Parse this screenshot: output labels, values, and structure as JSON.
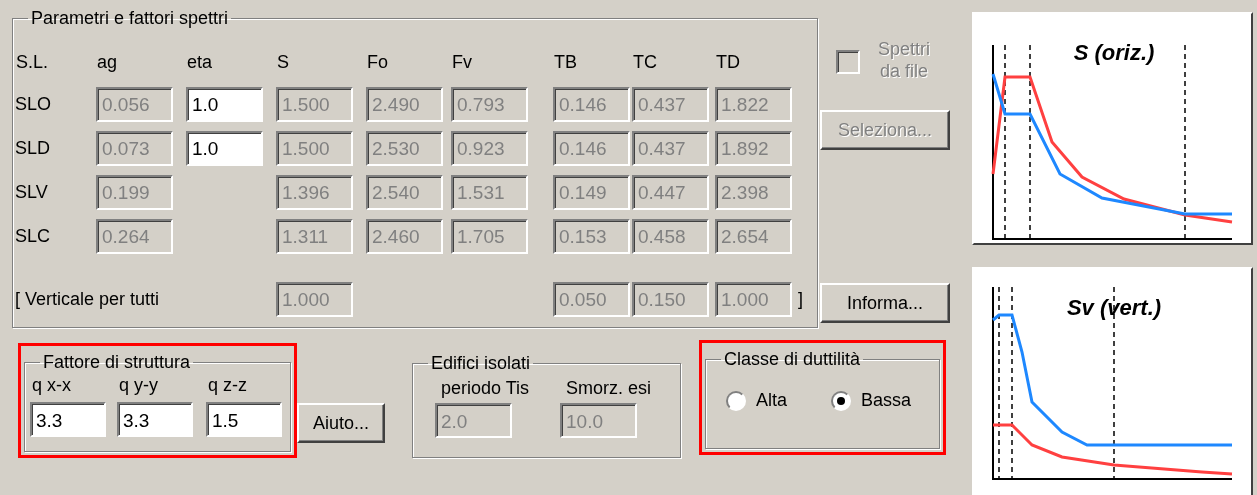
{
  "spectra": {
    "title": "Parametri e fattori spettri",
    "label_column": "S.L.",
    "columns": [
      "ag",
      "eta",
      "S",
      "Fo",
      "Fv",
      "TB",
      "TC",
      "TD"
    ],
    "rows": [
      {
        "kind": "state",
        "label": "SLO",
        "cells": [
          {
            "value": "0.056",
            "disabled": true
          },
          {
            "value": "1.0",
            "disabled": false
          },
          {
            "value": "1.500",
            "disabled": true
          },
          {
            "value": "2.490",
            "disabled": true
          },
          {
            "value": "0.793",
            "disabled": true
          },
          {
            "value": "0.146",
            "disabled": true
          },
          {
            "value": "0.437",
            "disabled": true
          },
          {
            "value": "1.822",
            "disabled": true
          }
        ]
      },
      {
        "kind": "state",
        "label": "SLD",
        "cells": [
          {
            "value": "0.073",
            "disabled": true
          },
          {
            "value": "1.0",
            "disabled": false
          },
          {
            "value": "1.500",
            "disabled": true
          },
          {
            "value": "2.530",
            "disabled": true
          },
          {
            "value": "0.923",
            "disabled": true
          },
          {
            "value": "0.146",
            "disabled": true
          },
          {
            "value": "0.437",
            "disabled": true
          },
          {
            "value": "1.892",
            "disabled": true
          }
        ]
      },
      {
        "kind": "state",
        "label": "SLV",
        "cells": [
          {
            "value": "0.199",
            "disabled": true
          },
          null,
          {
            "value": "1.396",
            "disabled": true
          },
          {
            "value": "2.540",
            "disabled": true
          },
          {
            "value": "1.531",
            "disabled": true
          },
          {
            "value": "0.149",
            "disabled": true
          },
          {
            "value": "0.447",
            "disabled": true
          },
          {
            "value": "2.398",
            "disabled": true
          }
        ]
      },
      {
        "kind": "state",
        "label": "SLC",
        "cells": [
          {
            "value": "0.264",
            "disabled": true
          },
          null,
          {
            "value": "1.311",
            "disabled": true
          },
          {
            "value": "2.460",
            "disabled": true
          },
          {
            "value": "1.705",
            "disabled": true
          },
          {
            "value": "0.153",
            "disabled": true
          },
          {
            "value": "0.458",
            "disabled": true
          },
          {
            "value": "2.654",
            "disabled": true
          }
        ]
      },
      {
        "kind": "vertical",
        "label": "[ Verticale per tutti",
        "closing": "]",
        "cells": [
          null,
          null,
          {
            "value": "1.000",
            "disabled": true
          },
          null,
          null,
          {
            "value": "0.050",
            "disabled": true
          },
          {
            "value": "0.150",
            "disabled": true
          },
          {
            "value": "1.000",
            "disabled": true
          }
        ]
      }
    ]
  },
  "file_spectra": {
    "label": "Spettri da file",
    "checked": false,
    "disabled": true
  },
  "select_button": {
    "label": "Seleziona...",
    "disabled": true
  },
  "info_button": {
    "label": "Informa...",
    "disabled": false
  },
  "structure_factor": {
    "title": "Fattore di struttura",
    "highlighted": true,
    "fields": [
      {
        "label": "q x-x",
        "value": "3.3",
        "disabled": false
      },
      {
        "label": "q y-y",
        "value": "3.3",
        "disabled": false
      },
      {
        "label": "q z-z",
        "value": "1.5",
        "disabled": false
      }
    ]
  },
  "help_button": {
    "label": "Aiuto...",
    "disabled": false
  },
  "isolated": {
    "title": "Edifici isolati",
    "fields": [
      {
        "label": "periodo Tis",
        "value": "2.0",
        "disabled": true
      },
      {
        "label": "Smorz. esi",
        "value": "10.0",
        "disabled": true
      }
    ]
  },
  "ductility": {
    "title": "Classe di duttilità",
    "highlighted": true,
    "options": [
      {
        "label": "Alta",
        "selected": false
      },
      {
        "label": "Bassa",
        "selected": true
      }
    ]
  },
  "charts": [
    {
      "kind": "horizontal",
      "title": "S (oriz.)"
    },
    {
      "kind": "vertical",
      "title": "Sv (vert.)"
    }
  ]
}
